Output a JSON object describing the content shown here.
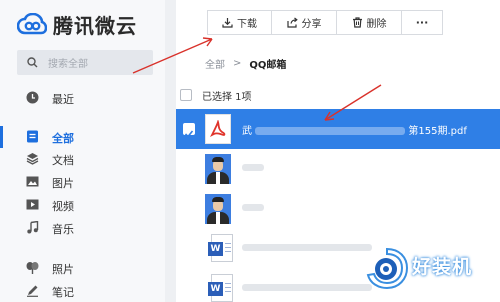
{
  "app": {
    "name": "腾讯微云",
    "brand_color": "#1e6fde"
  },
  "search": {
    "placeholder": "搜索全部"
  },
  "sidebar": {
    "recent": {
      "label": "最近",
      "icon": "clock-icon"
    },
    "items": [
      {
        "label": "全部",
        "icon": "all-files-icon",
        "active": true
      },
      {
        "label": "文档",
        "icon": "layers-icon"
      },
      {
        "label": "图片",
        "icon": "image-icon"
      },
      {
        "label": "视频",
        "icon": "video-icon"
      },
      {
        "label": "音乐",
        "icon": "music-icon"
      }
    ],
    "extra": [
      {
        "label": "照片",
        "icon": "photo-icon"
      },
      {
        "label": "笔记",
        "icon": "note-icon"
      }
    ]
  },
  "toolbar": {
    "download": "下载",
    "share": "分享",
    "delete": "删除",
    "more": "···"
  },
  "breadcrumb": {
    "root": "全部",
    "sep": ">",
    "current": "QQ邮箱"
  },
  "selection": {
    "text": "已选择 1项"
  },
  "files": [
    {
      "name_start": "武",
      "name_end": "第155期.pdf",
      "type": "pdf",
      "selected": true
    }
  ],
  "watermark": {
    "text": "好装机"
  }
}
